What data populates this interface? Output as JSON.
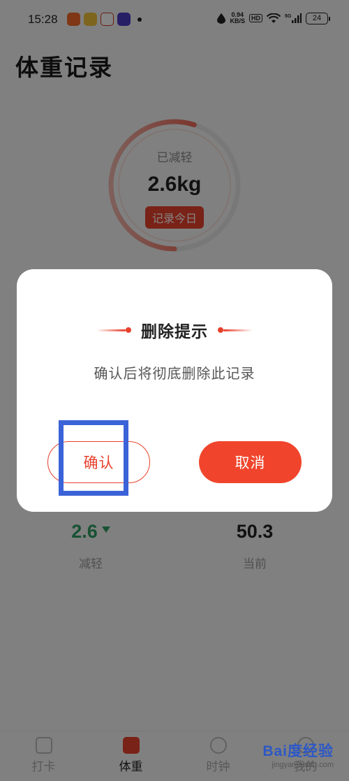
{
  "status_bar": {
    "time": "15:28",
    "network_speed": "0.94",
    "network_unit": "KB/S",
    "hd_badge": "HD",
    "battery": "24",
    "signal_label": "5G"
  },
  "page": {
    "title": "体重记录"
  },
  "summary": {
    "label": "已减轻",
    "value": "2.6kg",
    "record_button": "记录今日",
    "progress": 0.55
  },
  "stats": [
    {
      "value": "2.6",
      "label": "减轻"
    },
    {
      "value": "50.3",
      "label": "当前"
    }
  ],
  "bottom_nav": {
    "items": [
      {
        "label": "打卡",
        "icon": "calendar-icon"
      },
      {
        "label": "体重",
        "icon": "scale-icon"
      },
      {
        "label": "时钟",
        "icon": "clock-icon"
      },
      {
        "label": "我的",
        "icon": "person-icon"
      }
    ]
  },
  "dialog": {
    "title": "删除提示",
    "message": "确认后将彻底删除此记录",
    "confirm_label": "确认",
    "cancel_label": "取消"
  },
  "watermark": {
    "logo": "Bai度经验",
    "url": "jingyan.baidu.com"
  },
  "colors": {
    "accent": "#e8412d",
    "positive": "#2e9e63",
    "highlight": "#3b63d8"
  }
}
